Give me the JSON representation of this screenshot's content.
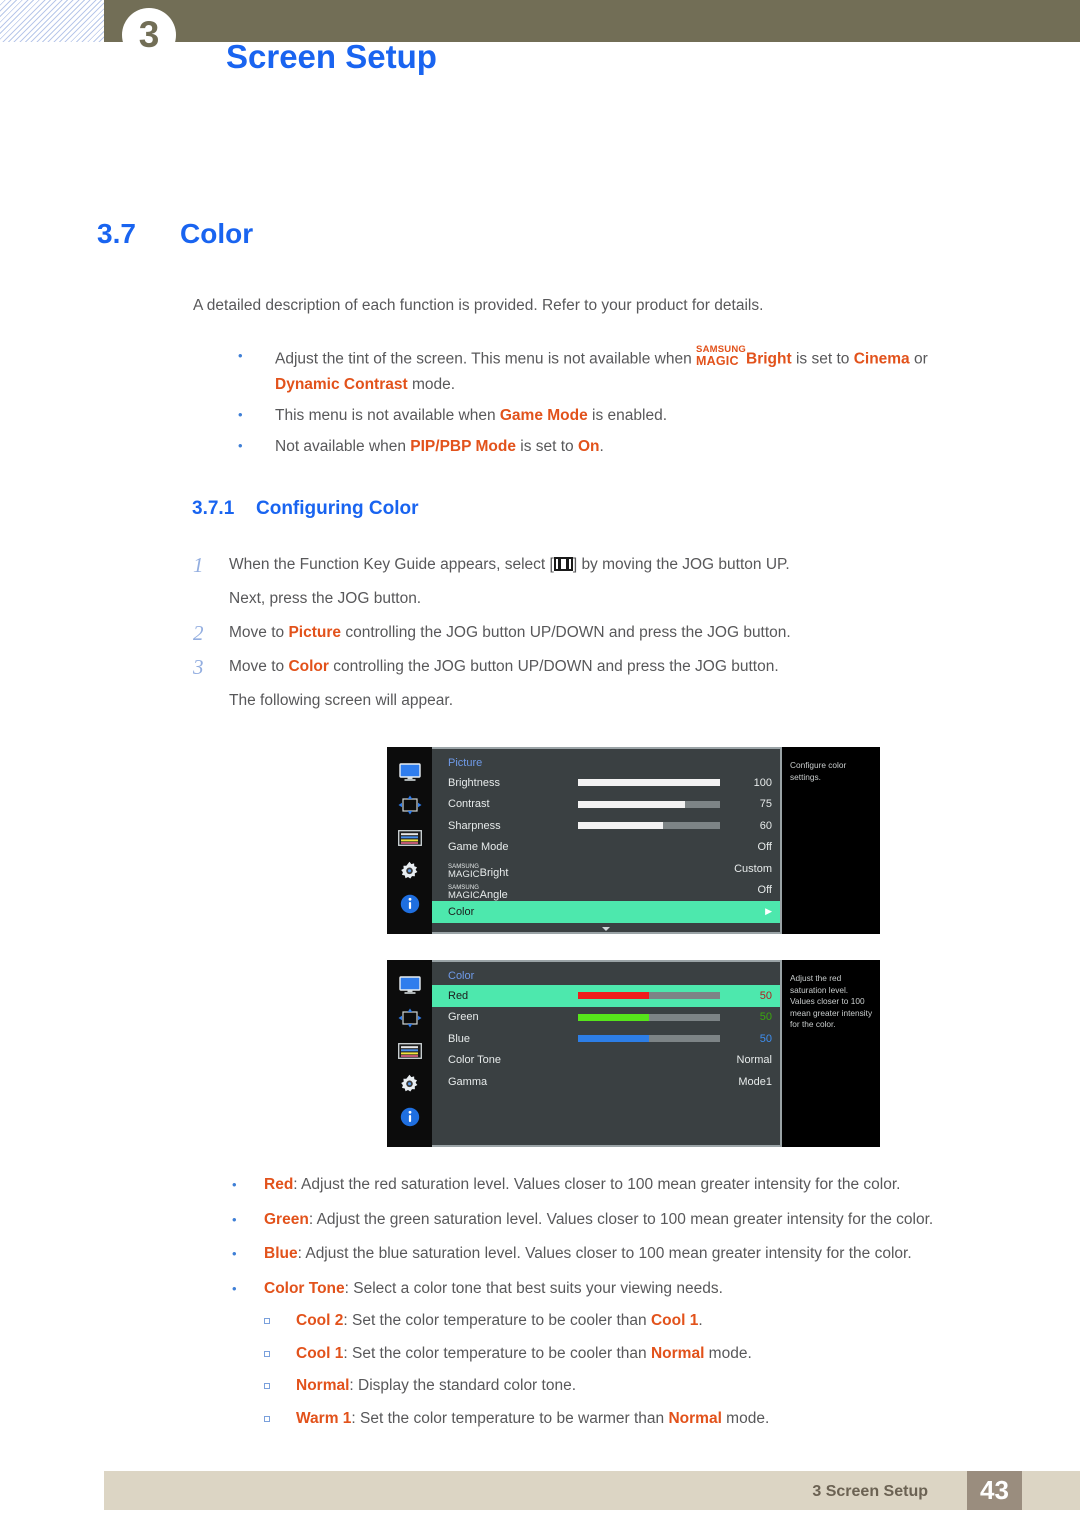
{
  "header": {
    "chapter_number": "3",
    "chapter_title": "Screen Setup"
  },
  "section": {
    "number": "3.7",
    "title": "Color"
  },
  "intro": "A detailed description of each function is provided. Refer to your product for details.",
  "notes": [
    {
      "parts": [
        {
          "t": "Adjust the tint of the screen. This menu is not available when ",
          "style": "normal"
        },
        {
          "t": "MAGIC",
          "style": "magic"
        },
        {
          "t": "Bright",
          "style": "orange-bold"
        },
        {
          "t": " is set to ",
          "style": "normal"
        },
        {
          "t": "Cinema",
          "style": "orange-bold"
        },
        {
          "t": " or ",
          "style": "normal"
        },
        {
          "t": "Dynamic Contrast",
          "style": "orange-bold"
        },
        {
          "t": " mode.",
          "style": "normal"
        }
      ]
    },
    {
      "parts": [
        {
          "t": "This menu is not available when ",
          "style": "normal"
        },
        {
          "t": "Game Mode",
          "style": "orange-bold"
        },
        {
          "t": " is enabled.",
          "style": "normal"
        }
      ]
    },
    {
      "parts": [
        {
          "t": "Not available when ",
          "style": "normal"
        },
        {
          "t": "PIP/PBP Mode",
          "style": "orange-bold"
        },
        {
          "t": " is set to ",
          "style": "normal"
        },
        {
          "t": "On",
          "style": "orange-bold"
        },
        {
          "t": ".",
          "style": "normal"
        }
      ]
    }
  ],
  "subsection": {
    "number": "3.7.1",
    "title": "Configuring Color"
  },
  "steps": [
    {
      "n": "1",
      "line1_a": "When the Function Key Guide appears, select [",
      "line1_b": "] by moving the JOG button UP.",
      "line2": "Next, press the JOG button."
    },
    {
      "n": "2",
      "pre": "Move to ",
      "hl": "Picture",
      "post": " controlling the JOG button UP/DOWN and press the JOG button."
    },
    {
      "n": "3",
      "pre": "Move to ",
      "hl": "Color",
      "post": " controlling the JOG button UP/DOWN and press the JOG button.",
      "line2": "The following screen will appear."
    }
  ],
  "osd_picture": {
    "title": "Picture",
    "description": "Configure color settings.",
    "sidebar_icons": [
      "monitor-icon",
      "pip-arrows-icon",
      "color-bars-icon",
      "gear-icon",
      "info-icon"
    ],
    "rows": [
      {
        "label": "Brightness",
        "value": "100",
        "bar": 100,
        "bar_color": "#f2f2f2",
        "selected": false
      },
      {
        "label": "Contrast",
        "value": "75",
        "bar": 75,
        "bar_color": "#f2f2f2",
        "selected": false
      },
      {
        "label": "Sharpness",
        "value": "60",
        "bar": 60,
        "bar_color": "#f2f2f2",
        "selected": false
      },
      {
        "label": "Game Mode",
        "value": "Off",
        "bar": null,
        "selected": false
      },
      {
        "label": "MAGICBright",
        "magic": true,
        "suffix": "Bright",
        "value": "Custom",
        "bar": null,
        "selected": false
      },
      {
        "label": "MAGICAngle",
        "magic": true,
        "suffix": "Angle",
        "value": "Off",
        "bar": null,
        "selected": false
      },
      {
        "label": "Color",
        "value": "",
        "bar": null,
        "selected": true,
        "arrow": "▶"
      }
    ]
  },
  "osd_color": {
    "title": "Color",
    "description": "Adjust the red saturation level. Values closer to 100 mean greater intensity for the color.",
    "sidebar_icons": [
      "monitor-icon",
      "pip-arrows-icon",
      "color-bars-icon",
      "gear-icon",
      "info-icon"
    ],
    "rows": [
      {
        "label": "Red",
        "value": "50",
        "bar": 50,
        "bar_color": "#ef1c1c",
        "value_color": "#b02020",
        "selected": true
      },
      {
        "label": "Green",
        "value": "50",
        "bar": 50,
        "bar_color": "#56e51b",
        "value_color": "#3aa80d",
        "selected": false
      },
      {
        "label": "Blue",
        "value": "50",
        "bar": 50,
        "bar_color": "#2d7ee6",
        "value_color": "#2d7ee6",
        "selected": false
      },
      {
        "label": "Color Tone",
        "value": "Normal",
        "bar": null,
        "selected": false
      },
      {
        "label": "Gamma",
        "value": "Mode1",
        "bar": null,
        "selected": false
      }
    ]
  },
  "descriptions": [
    {
      "term": "Red",
      "text": ": Adjust the red saturation level. Values closer to 100 mean greater intensity for the color."
    },
    {
      "term": "Green",
      "text": ": Adjust the green saturation level. Values closer to 100 mean greater intensity for the color."
    },
    {
      "term": "Blue",
      "text": ": Adjust the blue saturation level. Values closer to 100 mean greater intensity for the color."
    },
    {
      "term": "Color Tone",
      "text": ": Select a color tone that best suits your viewing needs."
    }
  ],
  "color_tone_options": [
    {
      "term": "Cool 2",
      "pre": ": Set the color temperature to be cooler than ",
      "ref": "Cool 1",
      "post": "."
    },
    {
      "term": "Cool 1",
      "pre": ": Set the color temperature to be cooler than ",
      "ref": "Normal",
      "post": " mode."
    },
    {
      "term": "Normal",
      "pre": ": Display the standard color tone.",
      "ref": "",
      "post": ""
    },
    {
      "term": "Warm 1",
      "pre": ": Set the color temperature to be warmer than ",
      "ref": "Normal",
      "post": " mode."
    }
  ],
  "footer": {
    "label": "3 Screen Setup",
    "page": "43"
  },
  "colors": {
    "accent_blue": "#1964f0",
    "orange": "#e2521b",
    "header_olive": "#726e56",
    "footer_beige": "#dcd5c4",
    "footer_page_bg": "#9a8d7e",
    "osd_highlight": "#4de8ad"
  }
}
